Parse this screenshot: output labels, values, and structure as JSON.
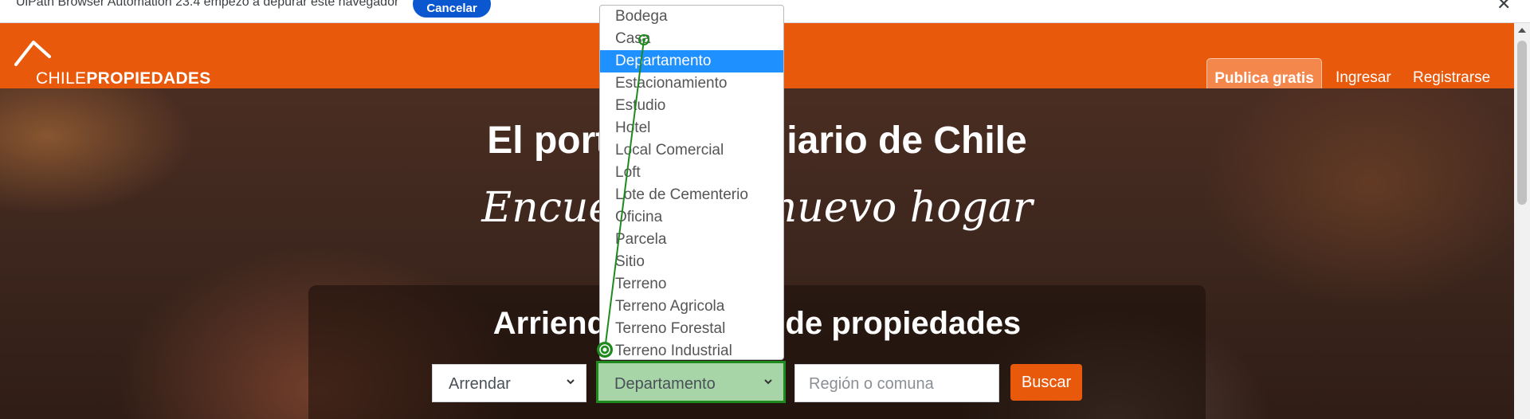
{
  "infobar": {
    "message": "UiPath Browser Automation 23.4 empezó a depurar este navegador",
    "cancel_label": "Cancelar",
    "close_glyph": "✕"
  },
  "header": {
    "logo_light": "CHILE",
    "logo_bold": "PROPIEDADES",
    "publica_label": "Publica gratis",
    "ingresar_label": "Ingresar",
    "registrarse_label": "Registrarse",
    "brand_color": "#e8590c"
  },
  "hero": {
    "title": "El portal inmobiliario de Chile",
    "subtitle": "Encuentra tu nuevo hogar"
  },
  "search": {
    "title": "Arrienda o compra de propiedades",
    "operacion_value": "Arrendar",
    "tipo_value": "Departamento",
    "region_placeholder": "Región o comuna",
    "buscar_label": "Buscar"
  },
  "dropdown": {
    "selected": "Departamento",
    "options": [
      "Bodega",
      "Casa",
      "Departamento",
      "Estacionamiento",
      "Estudio",
      "Hotel",
      "Local Comercial",
      "Loft",
      "Lote de Cementerio",
      "Oficina",
      "Parcela",
      "Sitio",
      "Terreno",
      "Terreno Agricola",
      "Terreno Forestal",
      "Terreno Industrial"
    ]
  },
  "icons": {
    "chevron": "chevron-down-icon",
    "logo_roof": "house-roof-icon",
    "target": "target-icon"
  }
}
